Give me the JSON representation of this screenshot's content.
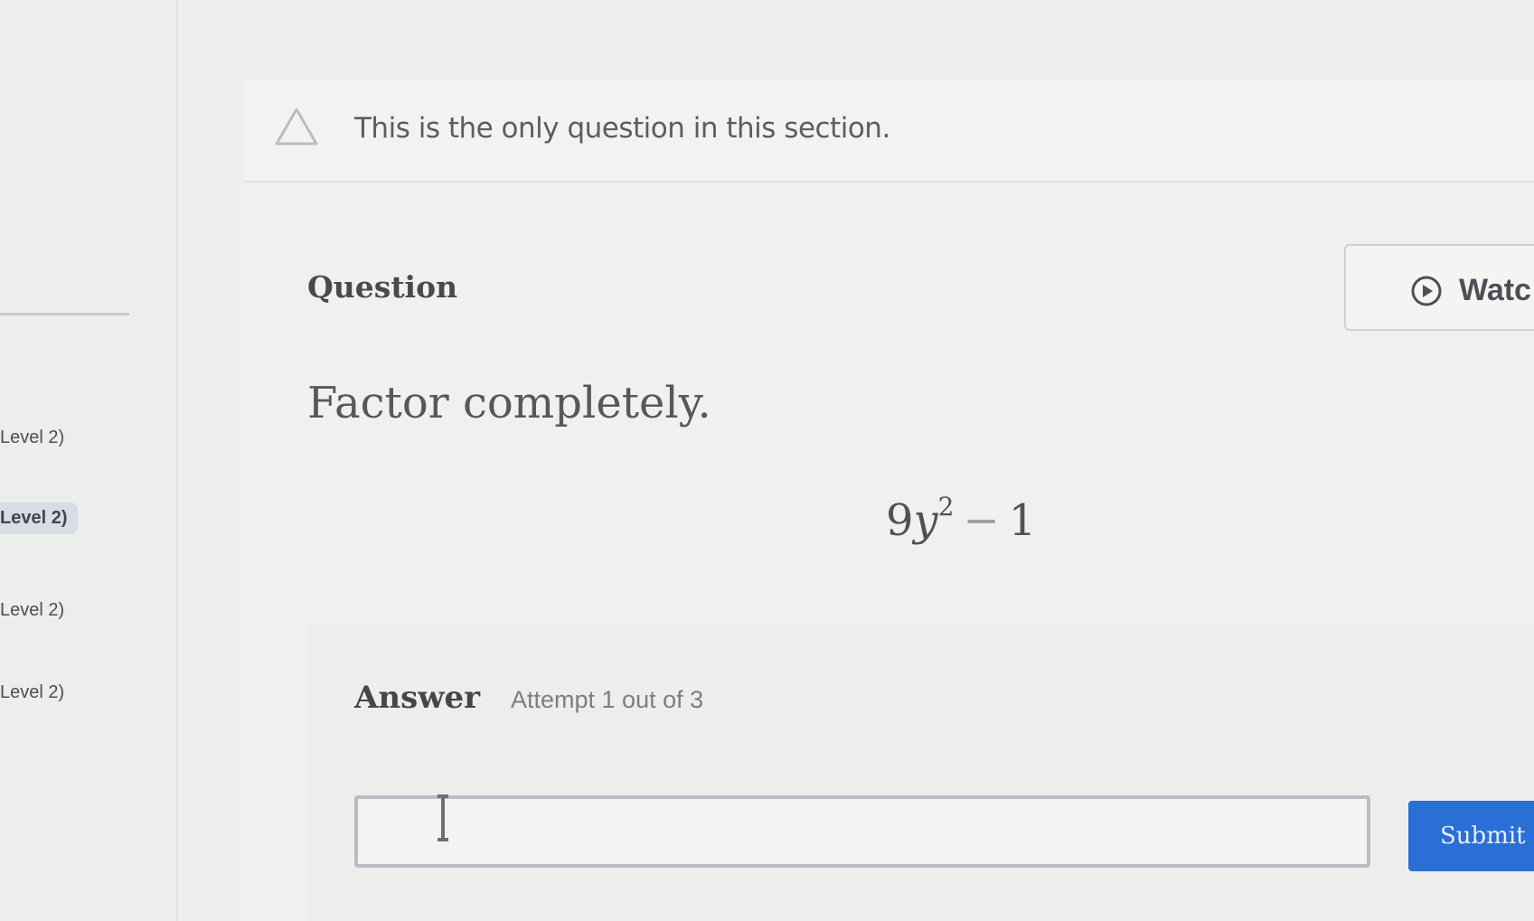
{
  "sidebar": {
    "items": [
      {
        "label": "Level 2)"
      },
      {
        "label": "Level 2)"
      },
      {
        "label": "Level 2)"
      },
      {
        "label": "Level 2)"
      }
    ]
  },
  "notice": {
    "text": "This is the only question in this section.",
    "icon": "warning-icon"
  },
  "question": {
    "heading": "Question",
    "watch_label": "Watc",
    "prompt": "Factor completely.",
    "expression": {
      "coefficient": "9",
      "variable": "y",
      "exponent": "2",
      "operator": "−",
      "constant": "1"
    }
  },
  "answer": {
    "heading": "Answer",
    "attempt": "Attempt 1 out of 3",
    "input_value": "",
    "submit_label": "Submit"
  },
  "colors": {
    "accent": "#2a6fd6",
    "background": "#eef0ed"
  }
}
